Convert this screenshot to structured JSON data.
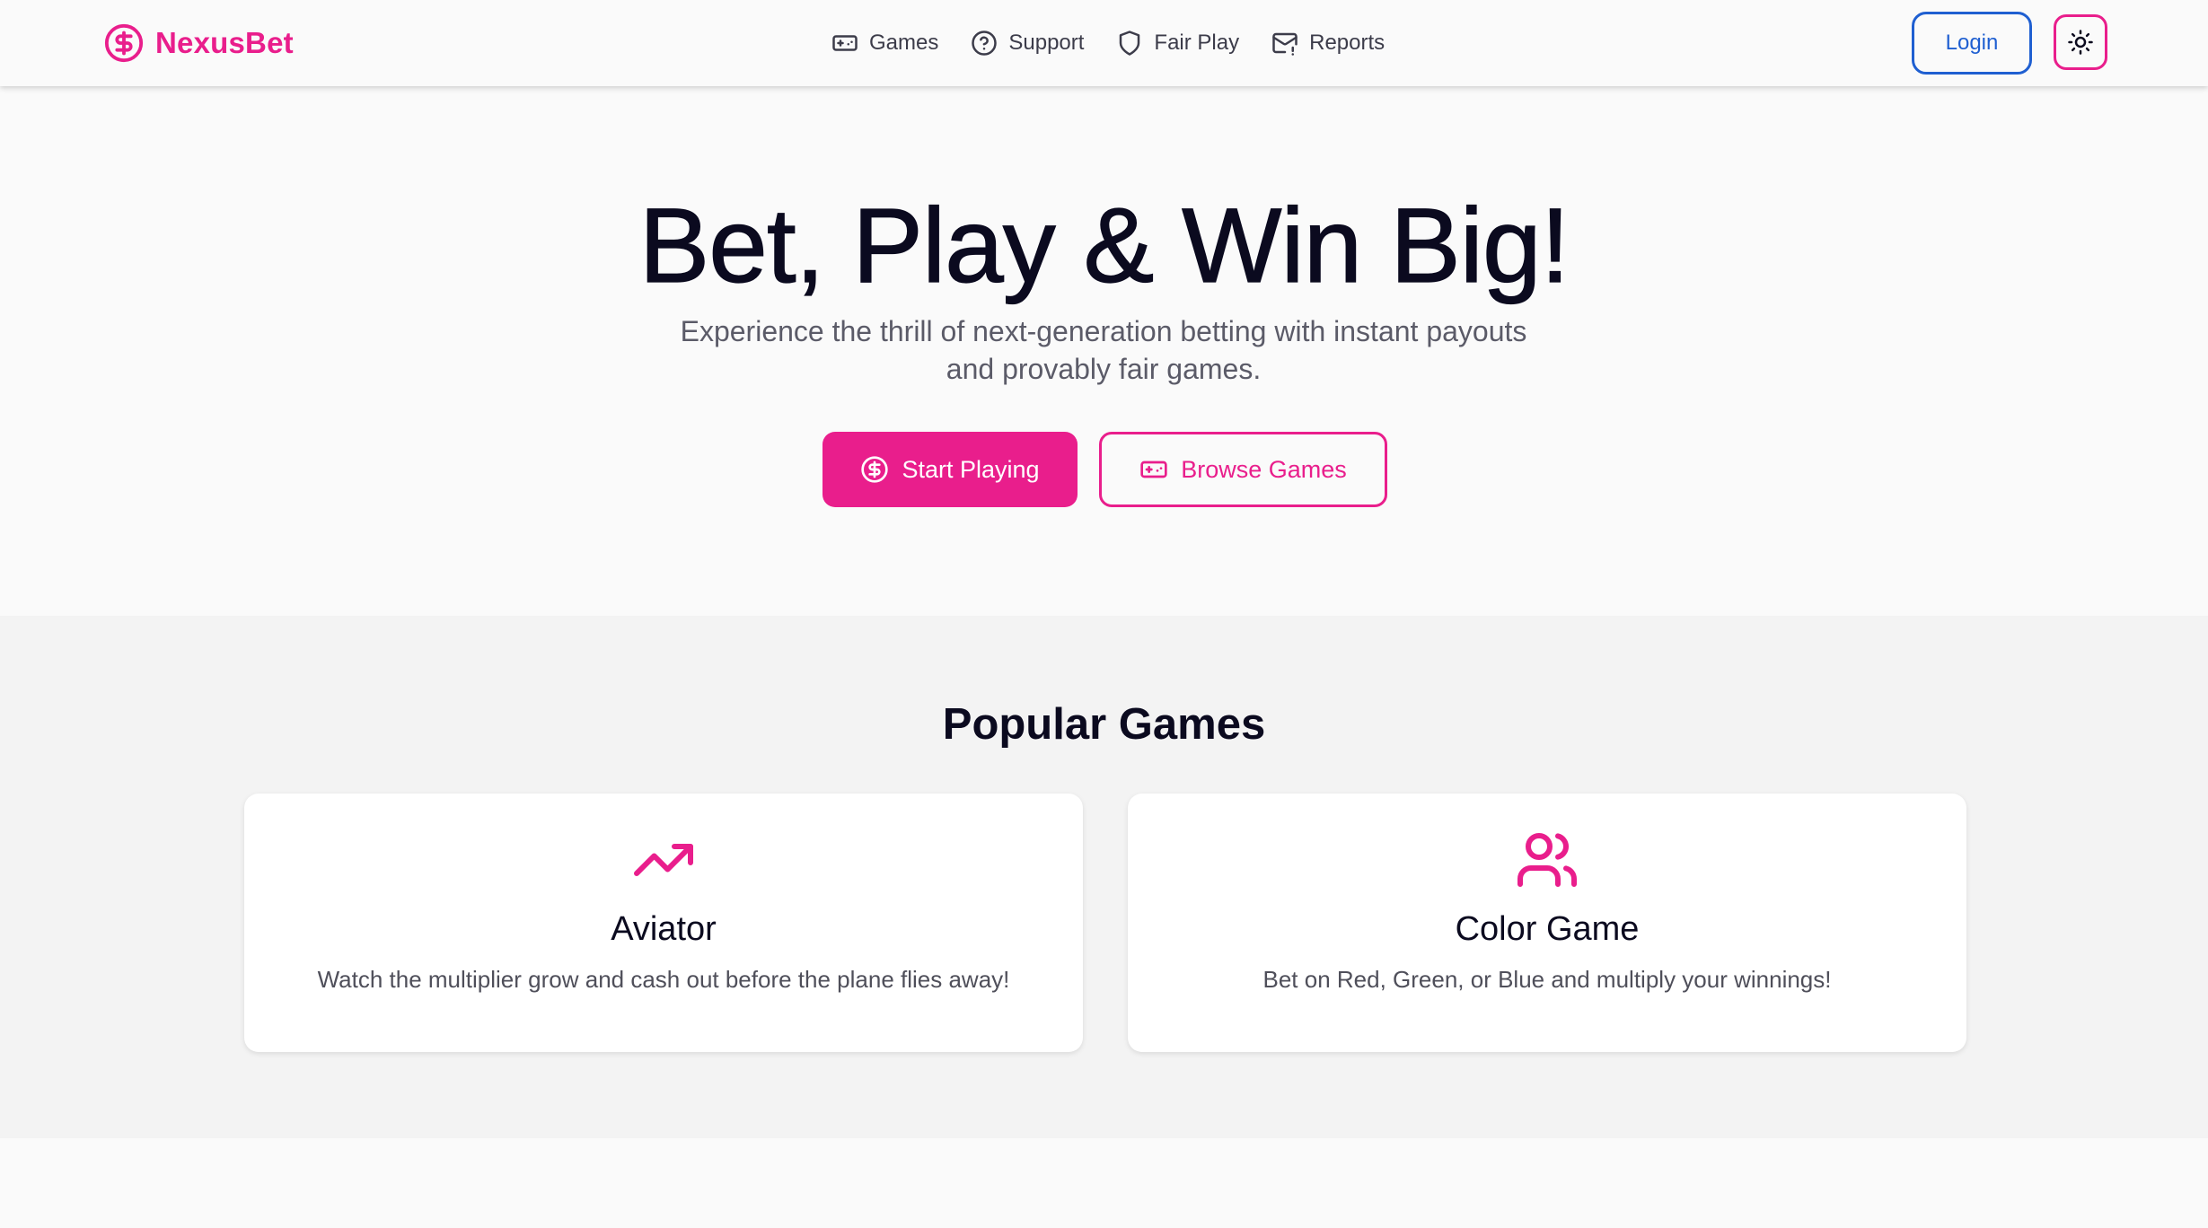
{
  "brand": {
    "name": "NexusBet",
    "icon": "dollar-circle-icon",
    "color": "#e91e8c"
  },
  "nav": {
    "items": [
      {
        "label": "Games",
        "icon": "gamepad-icon"
      },
      {
        "label": "Support",
        "icon": "help-circle-icon"
      },
      {
        "label": "Fair Play",
        "icon": "shield-icon"
      },
      {
        "label": "Reports",
        "icon": "mail-icon"
      }
    ]
  },
  "header": {
    "login_label": "Login",
    "theme_toggle_icon": "sun-icon"
  },
  "hero": {
    "title": "Bet, Play & Win Big!",
    "subtitle": "Experience the thrill of next-generation betting with instant payouts and provably fair games.",
    "start_label": "Start Playing",
    "browse_label": "Browse Games"
  },
  "games": {
    "title": "Popular Games",
    "cards": [
      {
        "title": "Aviator",
        "description": "Watch the multiplier grow and cash out before the plane flies away!",
        "icon": "trending-up-icon"
      },
      {
        "title": "Color Game",
        "description": "Bet on Red, Green, or Blue and multiply your winnings!",
        "icon": "users-icon"
      }
    ]
  },
  "colors": {
    "accent": "#e91e8c",
    "login_blue": "#1f5fd1",
    "text_dark": "#0b0a1f"
  }
}
